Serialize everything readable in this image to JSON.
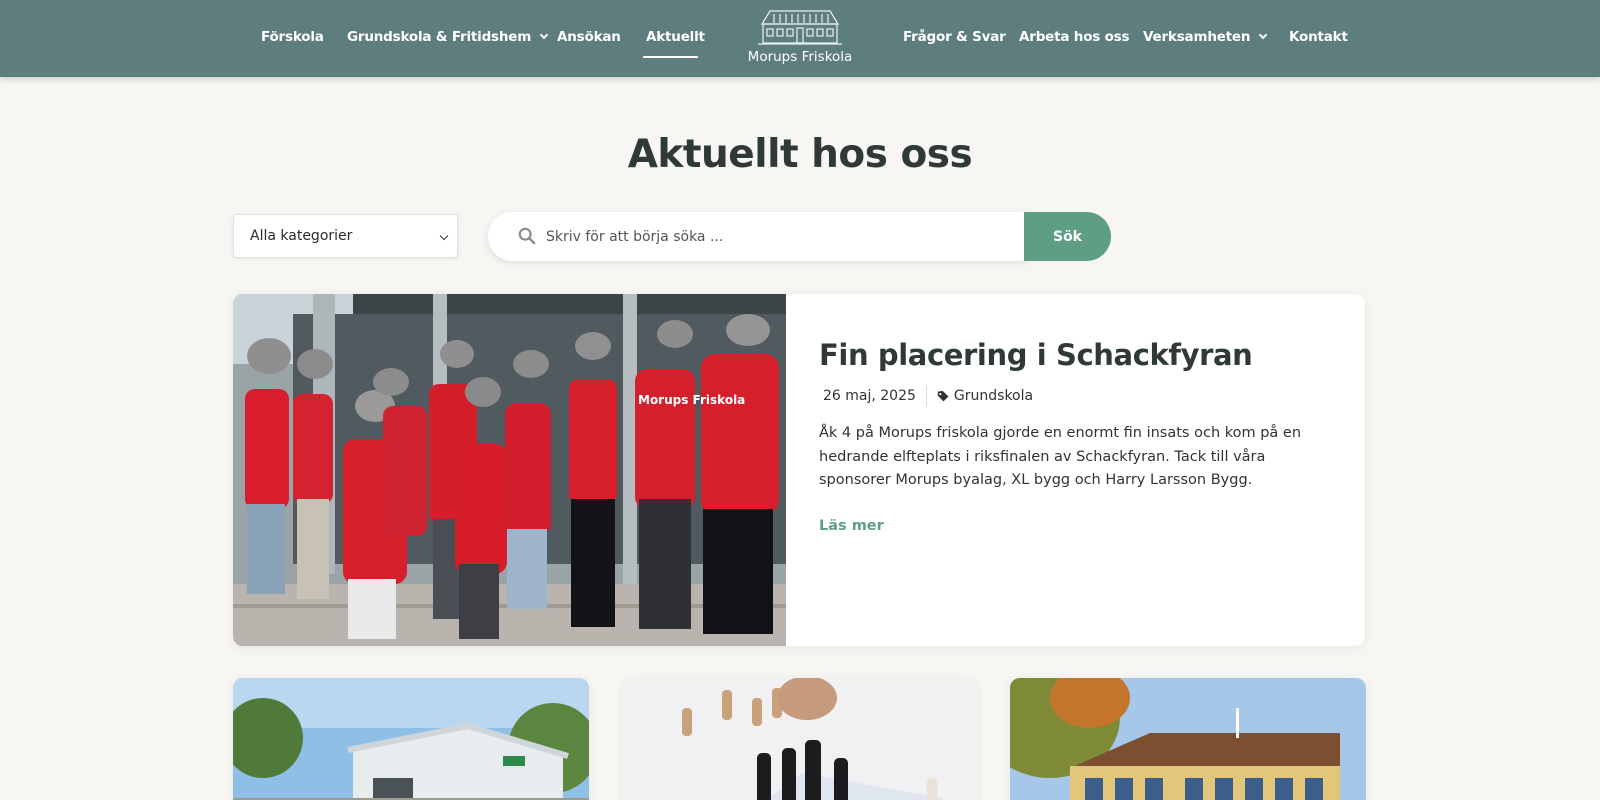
{
  "header": {
    "nav_left": [
      {
        "label": "Förskola",
        "has_dropdown": false
      },
      {
        "label": "Grundskola & Fritidshem",
        "has_dropdown": true
      },
      {
        "label": "Ansökan",
        "has_dropdown": false
      },
      {
        "label": "Aktuellt",
        "has_dropdown": false,
        "active": true
      }
    ],
    "logo_text": "Morups Friskola",
    "nav_right": [
      {
        "label": "Frågor & Svar",
        "has_dropdown": false
      },
      {
        "label": "Arbeta hos oss",
        "has_dropdown": false
      },
      {
        "label": "Verksamheten",
        "has_dropdown": true
      },
      {
        "label": "Kontakt",
        "has_dropdown": false
      }
    ],
    "bar_color": "#5e7d7f"
  },
  "main": {
    "title": "Aktuellt hos oss",
    "filter": {
      "selected": "Alla kategorier"
    },
    "search": {
      "placeholder": "Skriv för att börja söka ...",
      "value": "",
      "button_label": "Sök"
    },
    "featured_post": {
      "title": "Fin placering i Schackfyran",
      "date": "26 maj, 2025",
      "category": "Grundskola",
      "excerpt": "Åk 4 på Morups friskola gjorde en enormt fin insats och kom på en hedrande elfteplats i riksfinalen av Schackfyran. Tack till våra sponsorer Morups byalag, XL bygg och Harry Larsson Bygg.",
      "read_more": "Läs mer",
      "image": "students-red-shirts-photo",
      "shirt_text": "Morups Friskola"
    },
    "grid_posts": [
      {
        "image": "white-building-outdoor-photo"
      },
      {
        "image": "chess-pieces-photo"
      },
      {
        "image": "yellow-school-building-photo"
      }
    ]
  },
  "colors": {
    "accent": "#5e9e84",
    "header": "#5e7d7f",
    "background": "#f7f6f3",
    "text": "#2f3a38"
  }
}
